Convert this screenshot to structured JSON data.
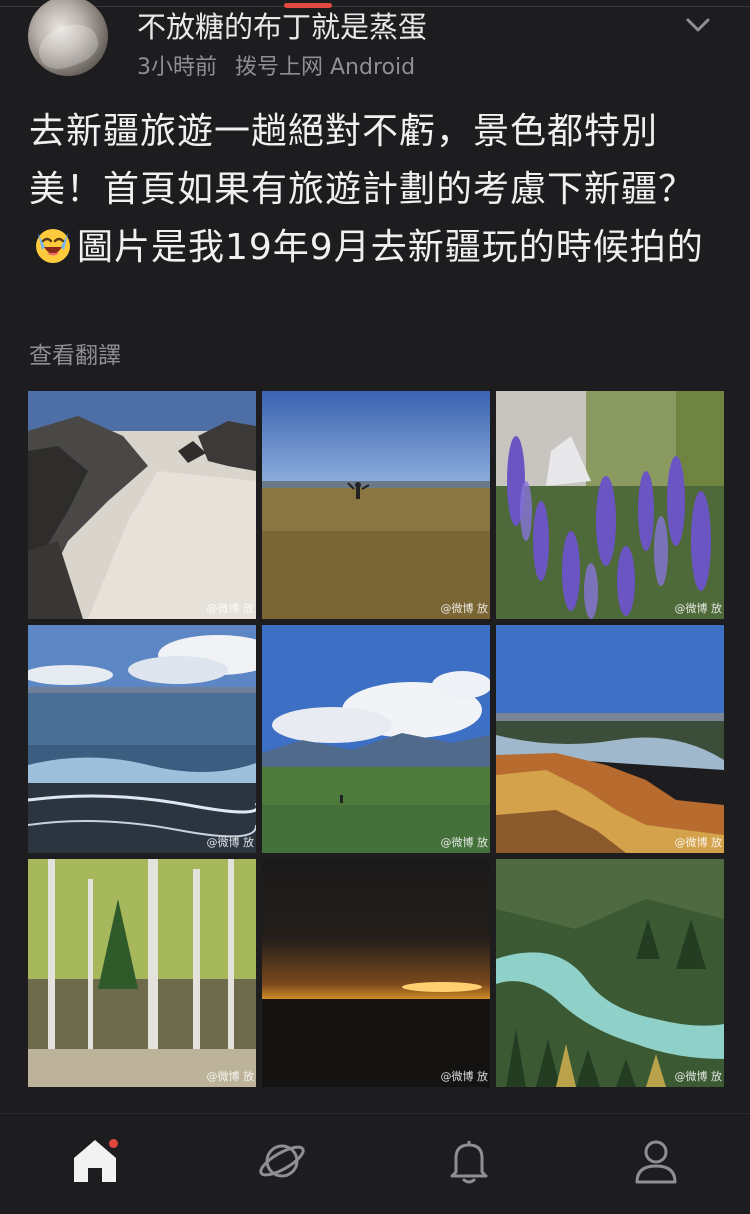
{
  "post": {
    "username": "不放糖的布丁就是蒸蛋",
    "time": "3小時前",
    "source": "拨号上网 Android",
    "text_before_emoji": "去新疆旅遊一趟絕對不虧，景色都特別美！首頁如果有旅遊計劃的考慮下新疆？",
    "text_after_emoji": "圖片是我19年9月去新疆玩的時候拍的",
    "translate_label": "查看翻譯"
  },
  "images": [
    {
      "subject": "sand-dune",
      "watermark": "@微博 放"
    },
    {
      "subject": "grassland-person",
      "watermark": "@微博 放"
    },
    {
      "subject": "lavender-flowers",
      "watermark": "@微博 放"
    },
    {
      "subject": "lake-waves",
      "watermark": "@微博 放"
    },
    {
      "subject": "meadow-mountains",
      "watermark": "@微博 放"
    },
    {
      "subject": "colorful-hills-river",
      "watermark": "@微博 放"
    },
    {
      "subject": "birch-forest",
      "watermark": "@微博 放"
    },
    {
      "subject": "sunset",
      "watermark": "@微博 放"
    },
    {
      "subject": "river-valley-forest",
      "watermark": "@微博 放"
    }
  ],
  "nav": {
    "items": [
      "home-icon",
      "planet-icon",
      "bell-icon",
      "profile-icon"
    ],
    "active": "home-icon",
    "notification_color": "#e2483f"
  },
  "colors": {
    "background": "#1d1d20",
    "accent": "#e2483f",
    "secondary_text": "#8e8e93"
  }
}
